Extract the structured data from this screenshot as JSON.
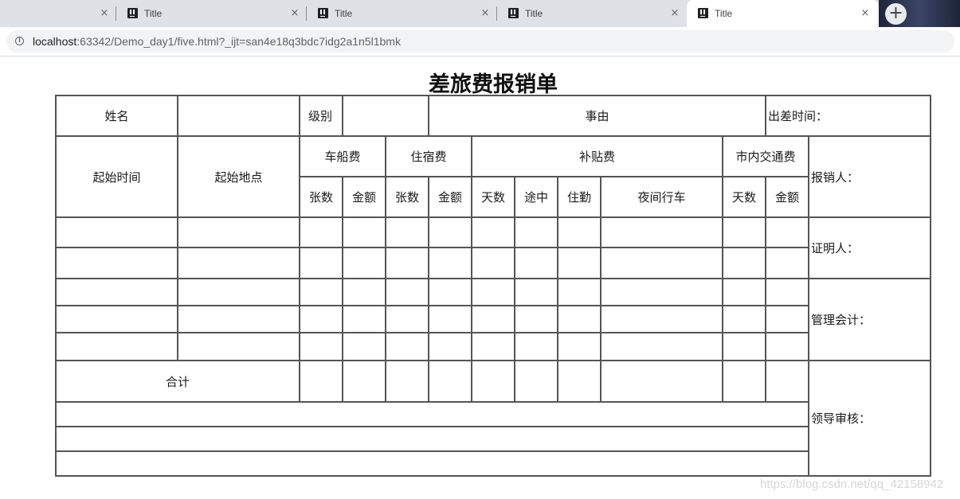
{
  "browser": {
    "tabs": [
      {
        "title": "Title",
        "active": false
      },
      {
        "title": "Title",
        "active": false
      },
      {
        "title": "Title",
        "active": false
      },
      {
        "title": "Title",
        "active": true
      }
    ],
    "close_glyph": "×",
    "new_tab_glyph": "+",
    "info_glyph": "i",
    "url_host": "localhost",
    "url_rest": ":63342/Demo_day1/five.html?_ijt=san4e18q3bdc7idg2a1n5l1bmk"
  },
  "form": {
    "title": "差旅费报销单",
    "name_label": "姓名",
    "level_label": "级别",
    "reason_label": "事由",
    "trip_time_label": "出差时间：",
    "start_time_label": "起始时间",
    "start_place_label": "起始地点",
    "groups": {
      "transport": "车船费",
      "lodging": "住宿费",
      "allowance": "补贴费",
      "local": "市内交通费"
    },
    "sub": {
      "count": "张数",
      "amount": "金额",
      "days": "天数",
      "transit": "途中",
      "stay": "住勤",
      "night": "夜间行车"
    },
    "total_label": "合计",
    "side": {
      "reimburser": "报销人：",
      "witness": "证明人：",
      "accountant": "管理会计：",
      "approver": "领导审核："
    }
  },
  "watermark": "https://blog.csdn.net/qq_42158942"
}
